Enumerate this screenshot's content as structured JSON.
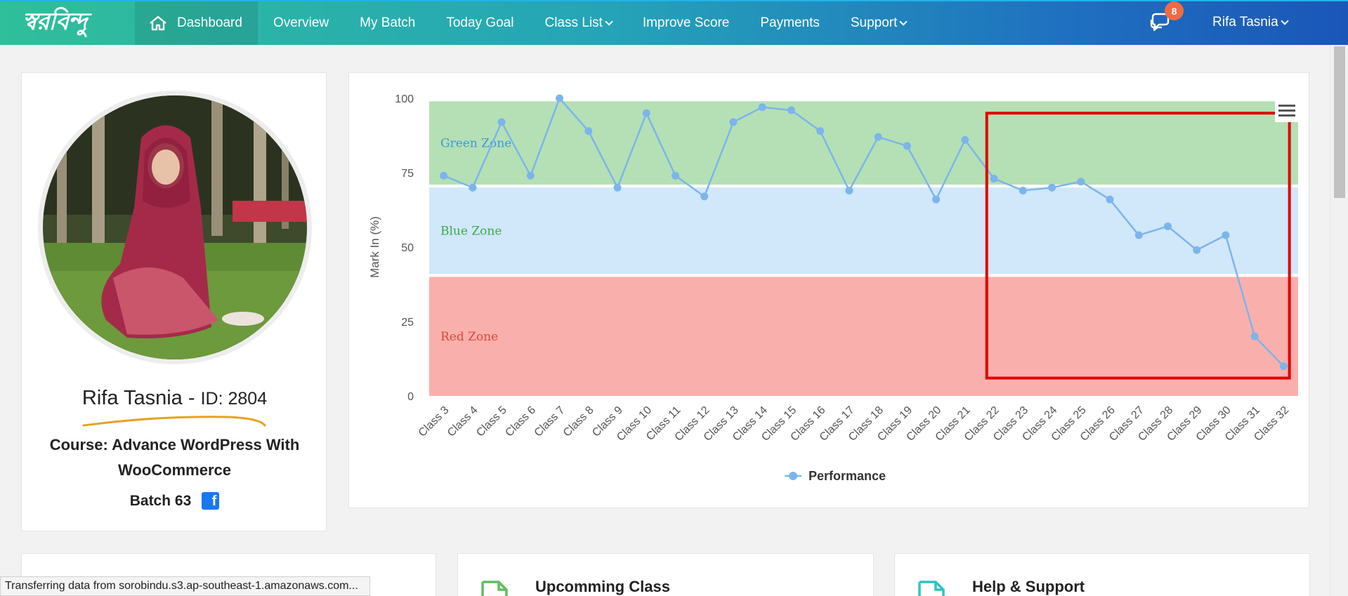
{
  "nav": {
    "logo_text": "স্বরবিন্দু",
    "items": [
      {
        "label": "Dashboard"
      },
      {
        "label": "Overview"
      },
      {
        "label": "My Batch"
      },
      {
        "label": "Today Goal"
      },
      {
        "label": "Class List"
      },
      {
        "label": "Improve Score"
      },
      {
        "label": "Payments"
      },
      {
        "label": "Support"
      }
    ],
    "message_count": "8",
    "user_name": "Rifa Tasnia"
  },
  "profile": {
    "name": "Rifa Tasnia",
    "separator": "-",
    "id_label": "ID: 2804",
    "course": "Course: Advance WordPress With WooCommerce",
    "batch": "Batch 63",
    "facebook_glyph": "f"
  },
  "chart_data": {
    "type": "line",
    "ylabel": "Mark In (%)",
    "ylim": [
      0,
      100
    ],
    "yticks": [
      0,
      25,
      50,
      75,
      100
    ],
    "categories": [
      "Class 3",
      "Class 4",
      "Class 5",
      "Class 6",
      "Class 7",
      "Class 8",
      "Class 9",
      "Class 10",
      "Class 11",
      "Class 12",
      "Class 13",
      "Class 14",
      "Class 15",
      "Class 16",
      "Class 17",
      "Class 18",
      "Class 19",
      "Class 20",
      "Class 21",
      "Class 22",
      "Class 23",
      "Class 24",
      "Class 25",
      "Class 26",
      "Class 27",
      "Class 28",
      "Class 29",
      "Class 30",
      "Class 31",
      "Class 32"
    ],
    "series": [
      {
        "name": "Performance",
        "color": "#7cb5ec",
        "values": [
          74,
          70,
          92,
          74,
          100,
          89,
          70,
          95,
          74,
          67,
          92,
          97,
          96,
          89,
          69,
          87,
          84,
          66,
          86,
          73,
          69,
          70,
          72,
          66,
          54,
          57,
          49,
          54,
          20,
          10
        ]
      }
    ],
    "bands": [
      {
        "label": "Green Zone",
        "from": 71,
        "to": 99,
        "color": "#b5e0b5",
        "label_color": "#3a9ad9"
      },
      {
        "label": "Blue Zone",
        "from": 41,
        "to": 70,
        "color": "#d1e7fa",
        "label_color": "#3aa84a"
      },
      {
        "label": "Red Zone",
        "from": 0,
        "to": 40,
        "color": "#f9b0ac",
        "label_color": "#e0483b"
      }
    ],
    "highlight": {
      "from_category": "Class 22",
      "to_category": "Class 32",
      "y_top": 95,
      "y_bottom": 6,
      "color": "#e00000"
    },
    "legend_position": "bottom-center",
    "grid": false
  },
  "cards": [
    {
      "title": ""
    },
    {
      "title": "Upcomming Class"
    },
    {
      "title": "Help & Support"
    }
  ],
  "status_text": "Transferring data from sorobindu.s3.ap-southeast-1.amazonaws.com..."
}
